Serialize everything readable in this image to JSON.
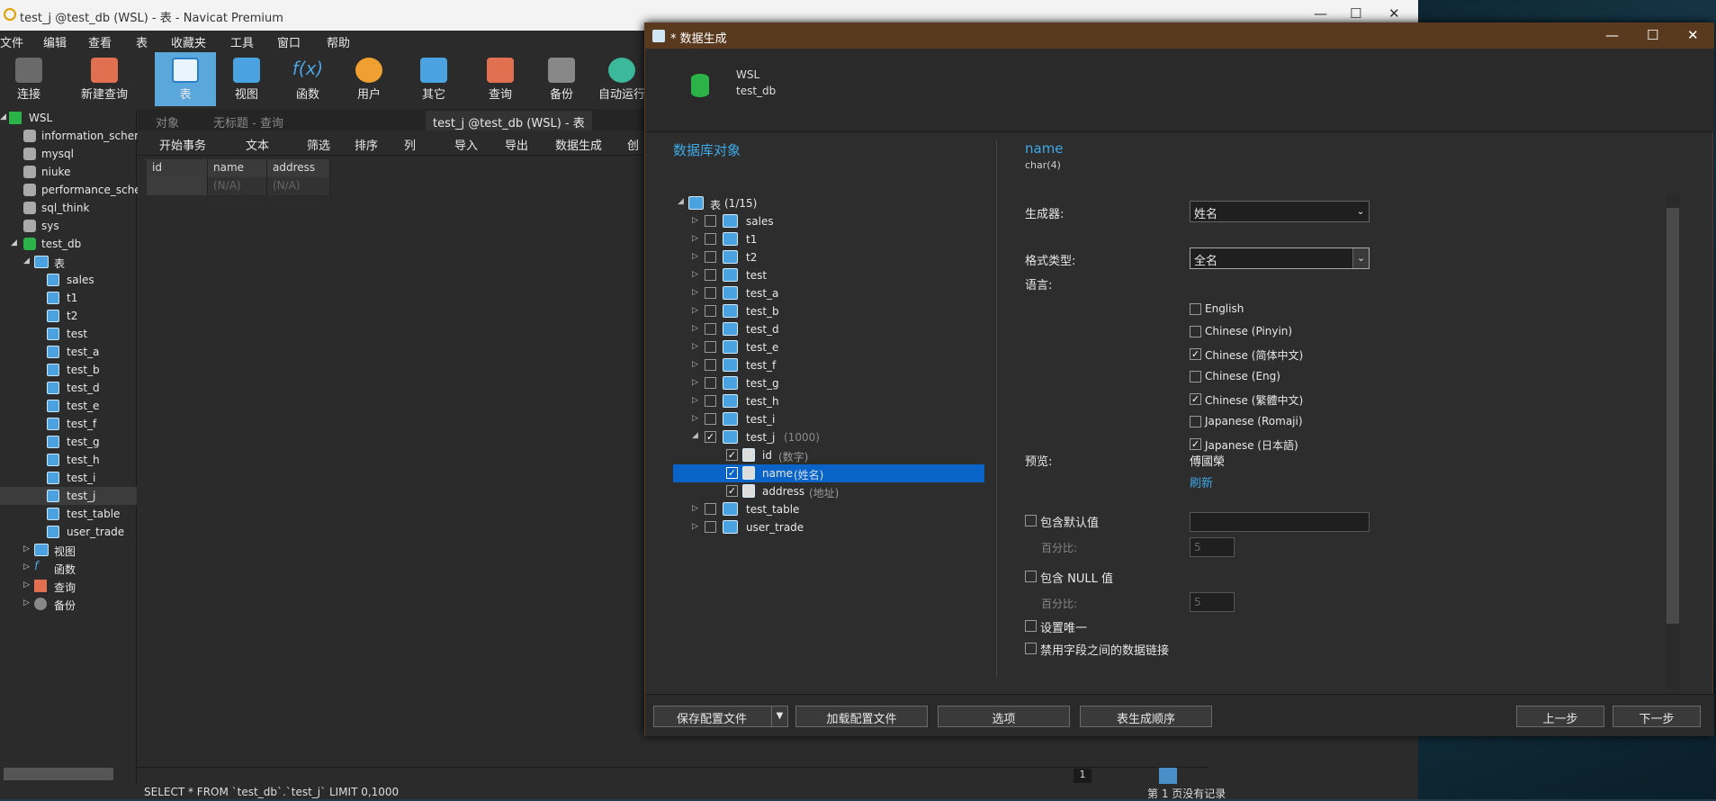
{
  "app": {
    "title": "test_j @test_db (WSL) - 表 - Navicat Premium",
    "min": "—",
    "max": "☐",
    "close": "✕"
  },
  "menu": [
    "文件",
    "编辑",
    "查看",
    "表",
    "收藏夹",
    "工具",
    "窗口",
    "帮助"
  ],
  "toolbar": {
    "items": [
      {
        "label": "连接",
        "icon": "connect-icon"
      },
      {
        "label": "新建查询",
        "icon": "new-query-icon"
      },
      {
        "label": "表",
        "icon": "table-icon"
      },
      {
        "label": "视图",
        "icon": "view-icon"
      },
      {
        "label": "函数",
        "icon": "function-icon"
      },
      {
        "label": "用户",
        "icon": "user-icon"
      },
      {
        "label": "其它",
        "icon": "other-icon"
      },
      {
        "label": "查询",
        "icon": "query-icon"
      },
      {
        "label": "备份",
        "icon": "backup-icon"
      },
      {
        "label": "自动运行",
        "icon": "automation-icon"
      }
    ],
    "fx": "f(x)"
  },
  "sidebar": {
    "connection": "WSL",
    "databases": [
      "information_schema",
      "mysql",
      "niuke",
      "performance_schema",
      "sql_think",
      "sys"
    ],
    "open_db": "test_db",
    "tables_group": "表",
    "tables": [
      "sales",
      "t1",
      "t2",
      "test",
      "test_a",
      "test_b",
      "test_d",
      "test_e",
      "test_f",
      "test_g",
      "test_h",
      "test_i",
      "test_j",
      "test_table",
      "user_trade"
    ],
    "groups": [
      "视图",
      "函数",
      "查询",
      "备份"
    ]
  },
  "tabs": {
    "objects": "对象",
    "untitled": "无标题 - 查询",
    "table": "test_j @test_db (WSL) - 表"
  },
  "subtoolbar": {
    "begin": "开始事务",
    "text": "文本",
    "filter": "筛选",
    "sort": "排序",
    "cols": "列",
    "import": "导入",
    "export": "导出",
    "datagen": "数据生成",
    "create": "创"
  },
  "grid": {
    "columns": [
      "id",
      "name",
      "address"
    ],
    "row": [
      "",
      "(N/A)",
      "(N/A)"
    ]
  },
  "bottom": {
    "page": "1"
  },
  "status": {
    "sql": "SELECT * FROM `test_db`.`test_j` LIMIT 0,1000",
    "records": "第 1 页没有记录"
  },
  "dialog": {
    "title": "* 数据生成",
    "conn": "WSL",
    "db": "test_db",
    "left_title": "数据库对象",
    "root": "表",
    "root_count": "(1/15)",
    "tables": [
      {
        "name": "sales",
        "checked": false
      },
      {
        "name": "t1",
        "checked": false
      },
      {
        "name": "t2",
        "checked": false
      },
      {
        "name": "test",
        "checked": false
      },
      {
        "name": "test_a",
        "checked": false
      },
      {
        "name": "test_b",
        "checked": false
      },
      {
        "name": "test_d",
        "checked": false
      },
      {
        "name": "test_e",
        "checked": false
      },
      {
        "name": "test_f",
        "checked": false
      },
      {
        "name": "test_g",
        "checked": false
      },
      {
        "name": "test_h",
        "checked": false
      },
      {
        "name": "test_i",
        "checked": false
      }
    ],
    "open_table": {
      "name": "test_j",
      "count": "(1000)"
    },
    "fields": [
      {
        "name": "id",
        "hint": "(数字)"
      },
      {
        "name": "name",
        "hint": "(姓名)"
      },
      {
        "name": "address",
        "hint": "(地址)"
      }
    ],
    "after_tables": [
      "test_table",
      "user_trade"
    ],
    "field": {
      "name": "name",
      "type": "char(4)"
    },
    "generator_label": "生成器:",
    "generator": "姓名",
    "format_label": "格式类型:",
    "format": "全名",
    "lang_label": "语言:",
    "languages": [
      {
        "label": "English",
        "checked": false
      },
      {
        "label": "Chinese (Pinyin)",
        "checked": false
      },
      {
        "label": "Chinese (简体中文)",
        "checked": true
      },
      {
        "label": "Chinese (Eng)",
        "checked": false
      },
      {
        "label": "Chinese (繁體中文)",
        "checked": true
      },
      {
        "label": "Japanese (Romaji)",
        "checked": false
      },
      {
        "label": "Japanese (日本語)",
        "checked": true
      }
    ],
    "preview_label": "预览:",
    "preview": "傅國榮",
    "refresh": "刷新",
    "default_label": "包含默认值",
    "percent_label": "百分比:",
    "percent_val": "5",
    "null_label": "包含 NULL 值",
    "unique_label": "设置唯一",
    "disable_link": "禁用字段之间的数据链接",
    "buttons": {
      "save": "保存配置文件",
      "load": "加载配置文件",
      "options": "选项",
      "order": "表生成顺序",
      "prev": "上一步",
      "next": "下一步"
    }
  }
}
